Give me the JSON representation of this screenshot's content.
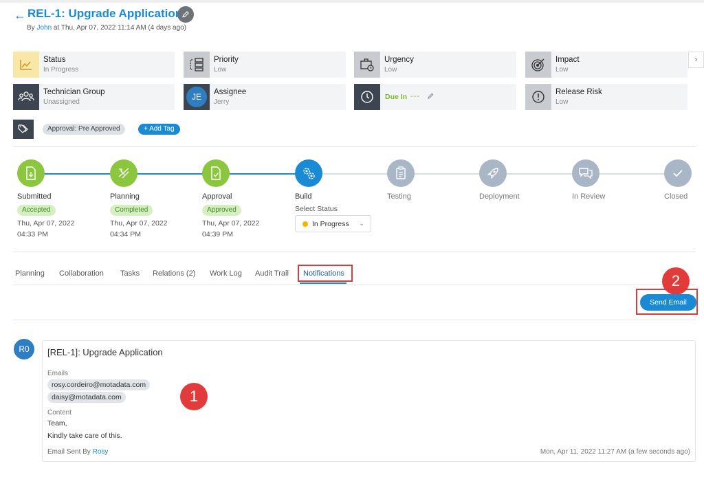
{
  "header": {
    "title": "REL-1: Upgrade Application",
    "by_prefix": "By",
    "author": "John",
    "timestamp": "at Thu, Apr 07, 2022 11:14 AM (4 days ago)"
  },
  "cards": {
    "status": {
      "label": "Status",
      "value": "In Progress"
    },
    "priority": {
      "label": "Priority",
      "value": "Low"
    },
    "urgency": {
      "label": "Urgency",
      "value": "Low"
    },
    "impact": {
      "label": "Impact",
      "value": "Low"
    },
    "technician_group": {
      "label": "Technician Group",
      "value": "Unassigned"
    },
    "assignee": {
      "label": "Assignee",
      "value": "Jerry",
      "initials": "JE"
    },
    "due_in": {
      "label": "Due In",
      "value": "---"
    },
    "release_risk": {
      "label": "Release Risk",
      "value": "Low"
    }
  },
  "tags": {
    "items": [
      "Approval: Pre Approved"
    ],
    "add_label": "+ Add Tag"
  },
  "stages": [
    {
      "name": "Submitted",
      "badge": "Accepted",
      "date": "Thu, Apr 07, 2022",
      "time": "04:33 PM",
      "state": "done"
    },
    {
      "name": "Planning",
      "badge": "Completed",
      "date": "Thu, Apr 07, 2022",
      "time": "04:34 PM",
      "state": "done"
    },
    {
      "name": "Approval",
      "badge": "Approved",
      "date": "Thu, Apr 07, 2022",
      "time": "04:39 PM",
      "state": "done"
    },
    {
      "name": "Build",
      "state": "current"
    },
    {
      "name": "Testing",
      "state": "pending"
    },
    {
      "name": "Deployment",
      "state": "pending"
    },
    {
      "name": "In Review",
      "state": "pending"
    },
    {
      "name": "Closed",
      "state": "pending"
    }
  ],
  "build_status": {
    "label": "Select Status",
    "value": "In Progress"
  },
  "tabs": [
    "Planning",
    "Collaboration",
    "Tasks",
    "Relations (2)",
    "Work Log",
    "Audit Trail",
    "Notifications"
  ],
  "active_tab": "Notifications",
  "send_email_label": "Send Email",
  "annotations": [
    "1",
    "2"
  ],
  "notification": {
    "avatar_initials": "R0",
    "title": "[REL-1]: Upgrade Application",
    "emails_label": "Emails",
    "emails": [
      "rosy.cordeiro@motadata.com",
      "daisy@motadata.com"
    ],
    "content_label": "Content",
    "content_lines": [
      "Team,",
      "Kindly take care of this."
    ],
    "sent_by_label": "Email Sent By",
    "sent_by": "Rosy",
    "sent_time": "Mon, Apr 11, 2022 11:27 AM (a few seconds ago)"
  },
  "colors": {
    "accent": "#1a8ad4",
    "stage_done": "#8cc63f",
    "stage_pending": "#a9b6c6",
    "annotation_red": "#e23b3b"
  }
}
